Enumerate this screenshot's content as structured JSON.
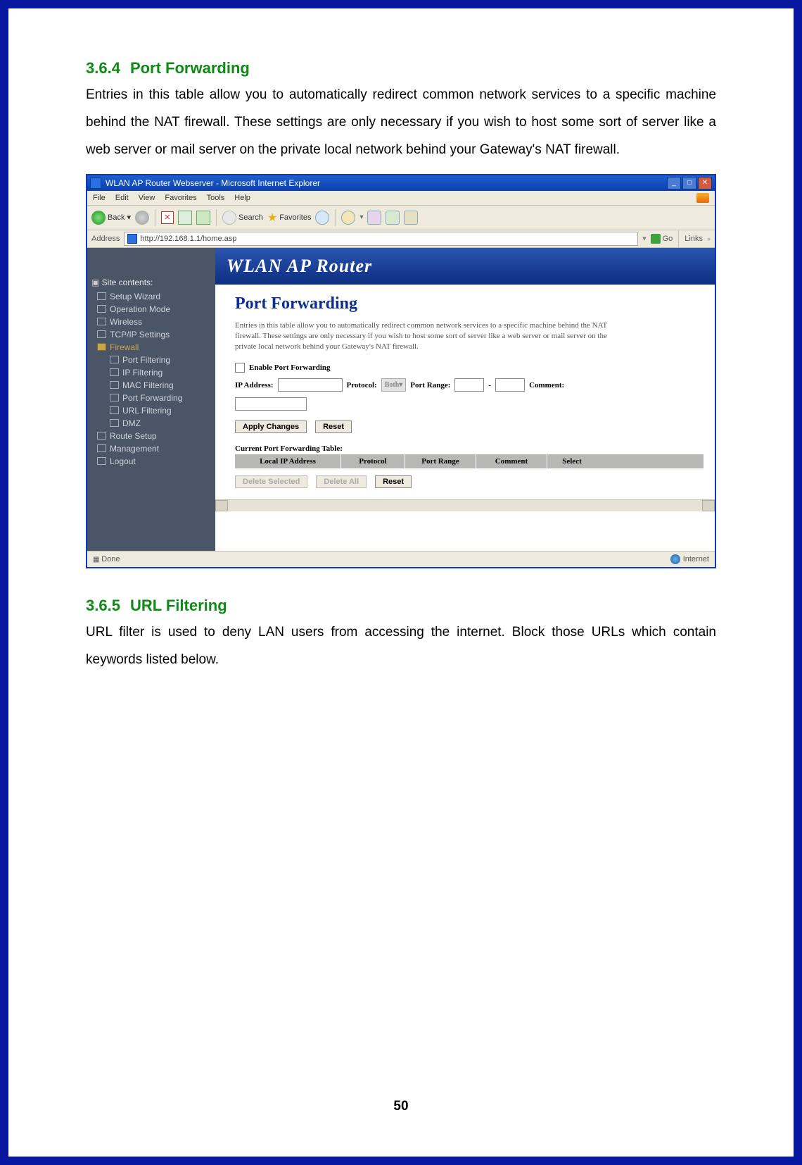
{
  "section1": {
    "num": "3.6.4",
    "title": "Port Forwarding",
    "body": "Entries in this table allow you to automatically redirect common network services to a specific machine behind the NAT firewall. These settings are only necessary if you wish to host some sort of server like a web server or mail server on the private local network behind your Gateway's NAT firewall."
  },
  "section2": {
    "num": "3.6.5",
    "title": "URL Filtering",
    "body": "URL filter is used to deny LAN users from accessing the internet. Block those URLs which contain keywords listed below."
  },
  "page_number": "50",
  "ie": {
    "window_title": "WLAN AP Router Webserver - Microsoft Internet Explorer",
    "menus": [
      "File",
      "Edit",
      "View",
      "Favorites",
      "Tools",
      "Help"
    ],
    "toolbar": {
      "back": "Back",
      "search": "Search",
      "favorites": "Favorites"
    },
    "address_label": "Address",
    "address_value": "http://192.168.1.1/home.asp",
    "go": "Go",
    "links": "Links",
    "status_left": "Done",
    "status_right": "Internet"
  },
  "router": {
    "banner": "WLAN AP Router",
    "side_head": "Site contents:",
    "nav": [
      "Setup Wizard",
      "Operation Mode",
      "Wireless",
      "TCP/IP Settings"
    ],
    "fw_folder": "Firewall",
    "fw_items": [
      "Port Filtering",
      "IP Filtering",
      "MAC Filtering",
      "Port Forwarding",
      "URL Filtering",
      "DMZ"
    ],
    "nav2": [
      "Route Setup",
      "Management",
      "Logout"
    ],
    "pf_title": "Port Forwarding",
    "pf_desc": "Entries in this table allow you to automatically redirect common network services to a specific machine behind the NAT firewall. These settings are only necessary if you wish to host some sort of server like a web server or mail server on the private local network behind your Gateway's NAT firewall.",
    "enable": "Enable Port Forwarding",
    "ip_label": "IP Address:",
    "proto_label": "Protocol:",
    "proto_value": "Both",
    "range_label": "Port Range:",
    "comment_label": "Comment:",
    "apply": "Apply Changes",
    "reset": "Reset",
    "table_title": "Current Port Forwarding Table:",
    "cols": [
      "Local IP Address",
      "Protocol",
      "Port Range",
      "Comment",
      "Select"
    ],
    "del_sel": "Delete Selected",
    "del_all": "Delete All",
    "reset2": "Reset"
  }
}
